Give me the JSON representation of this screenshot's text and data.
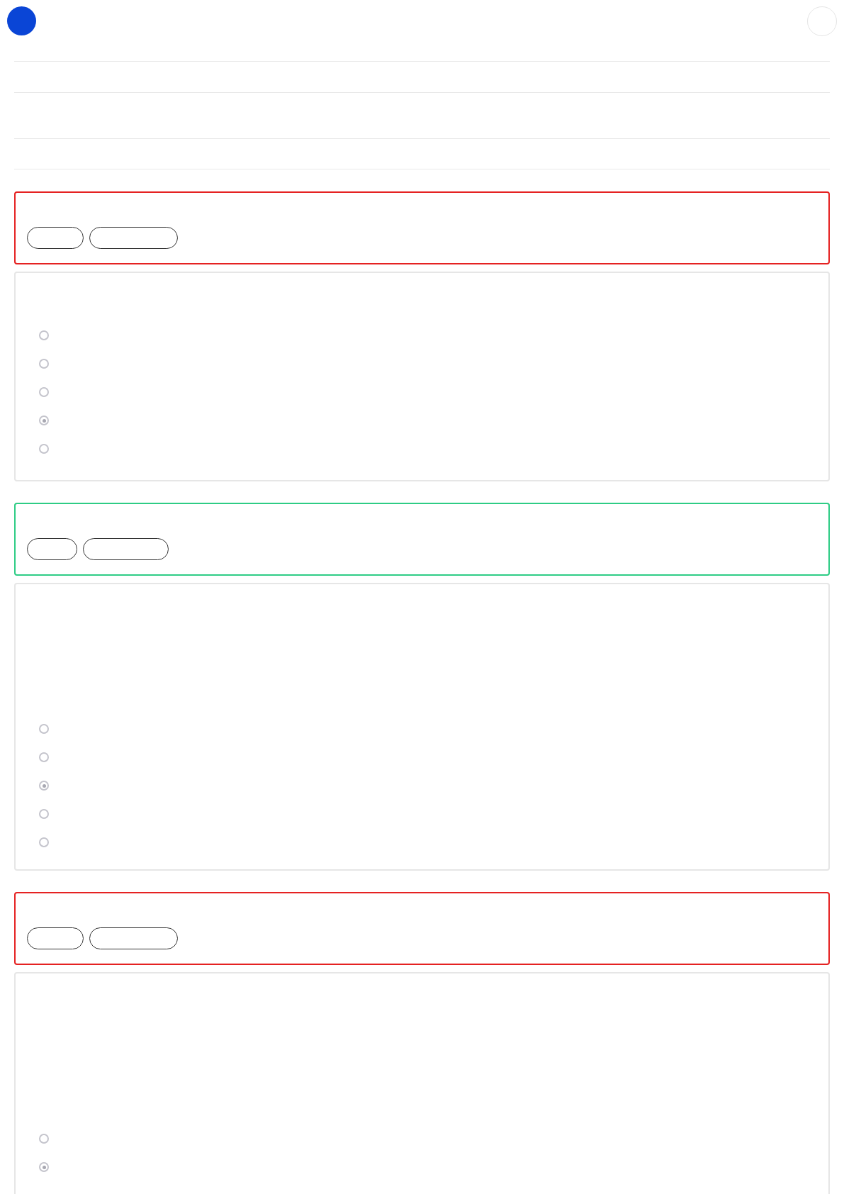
{
  "results": [
    {
      "color": "#e52222",
      "options": [
        {
          "selected": false
        },
        {
          "selected": false
        },
        {
          "selected": false
        },
        {
          "selected": true
        },
        {
          "selected": false
        }
      ]
    },
    {
      "color": "#2ecc85",
      "options": [
        {
          "selected": false
        },
        {
          "selected": false
        },
        {
          "selected": true
        },
        {
          "selected": false
        },
        {
          "selected": false
        }
      ]
    },
    {
      "color": "#e52222",
      "options": [
        {
          "selected": false
        },
        {
          "selected": true
        }
      ]
    }
  ]
}
